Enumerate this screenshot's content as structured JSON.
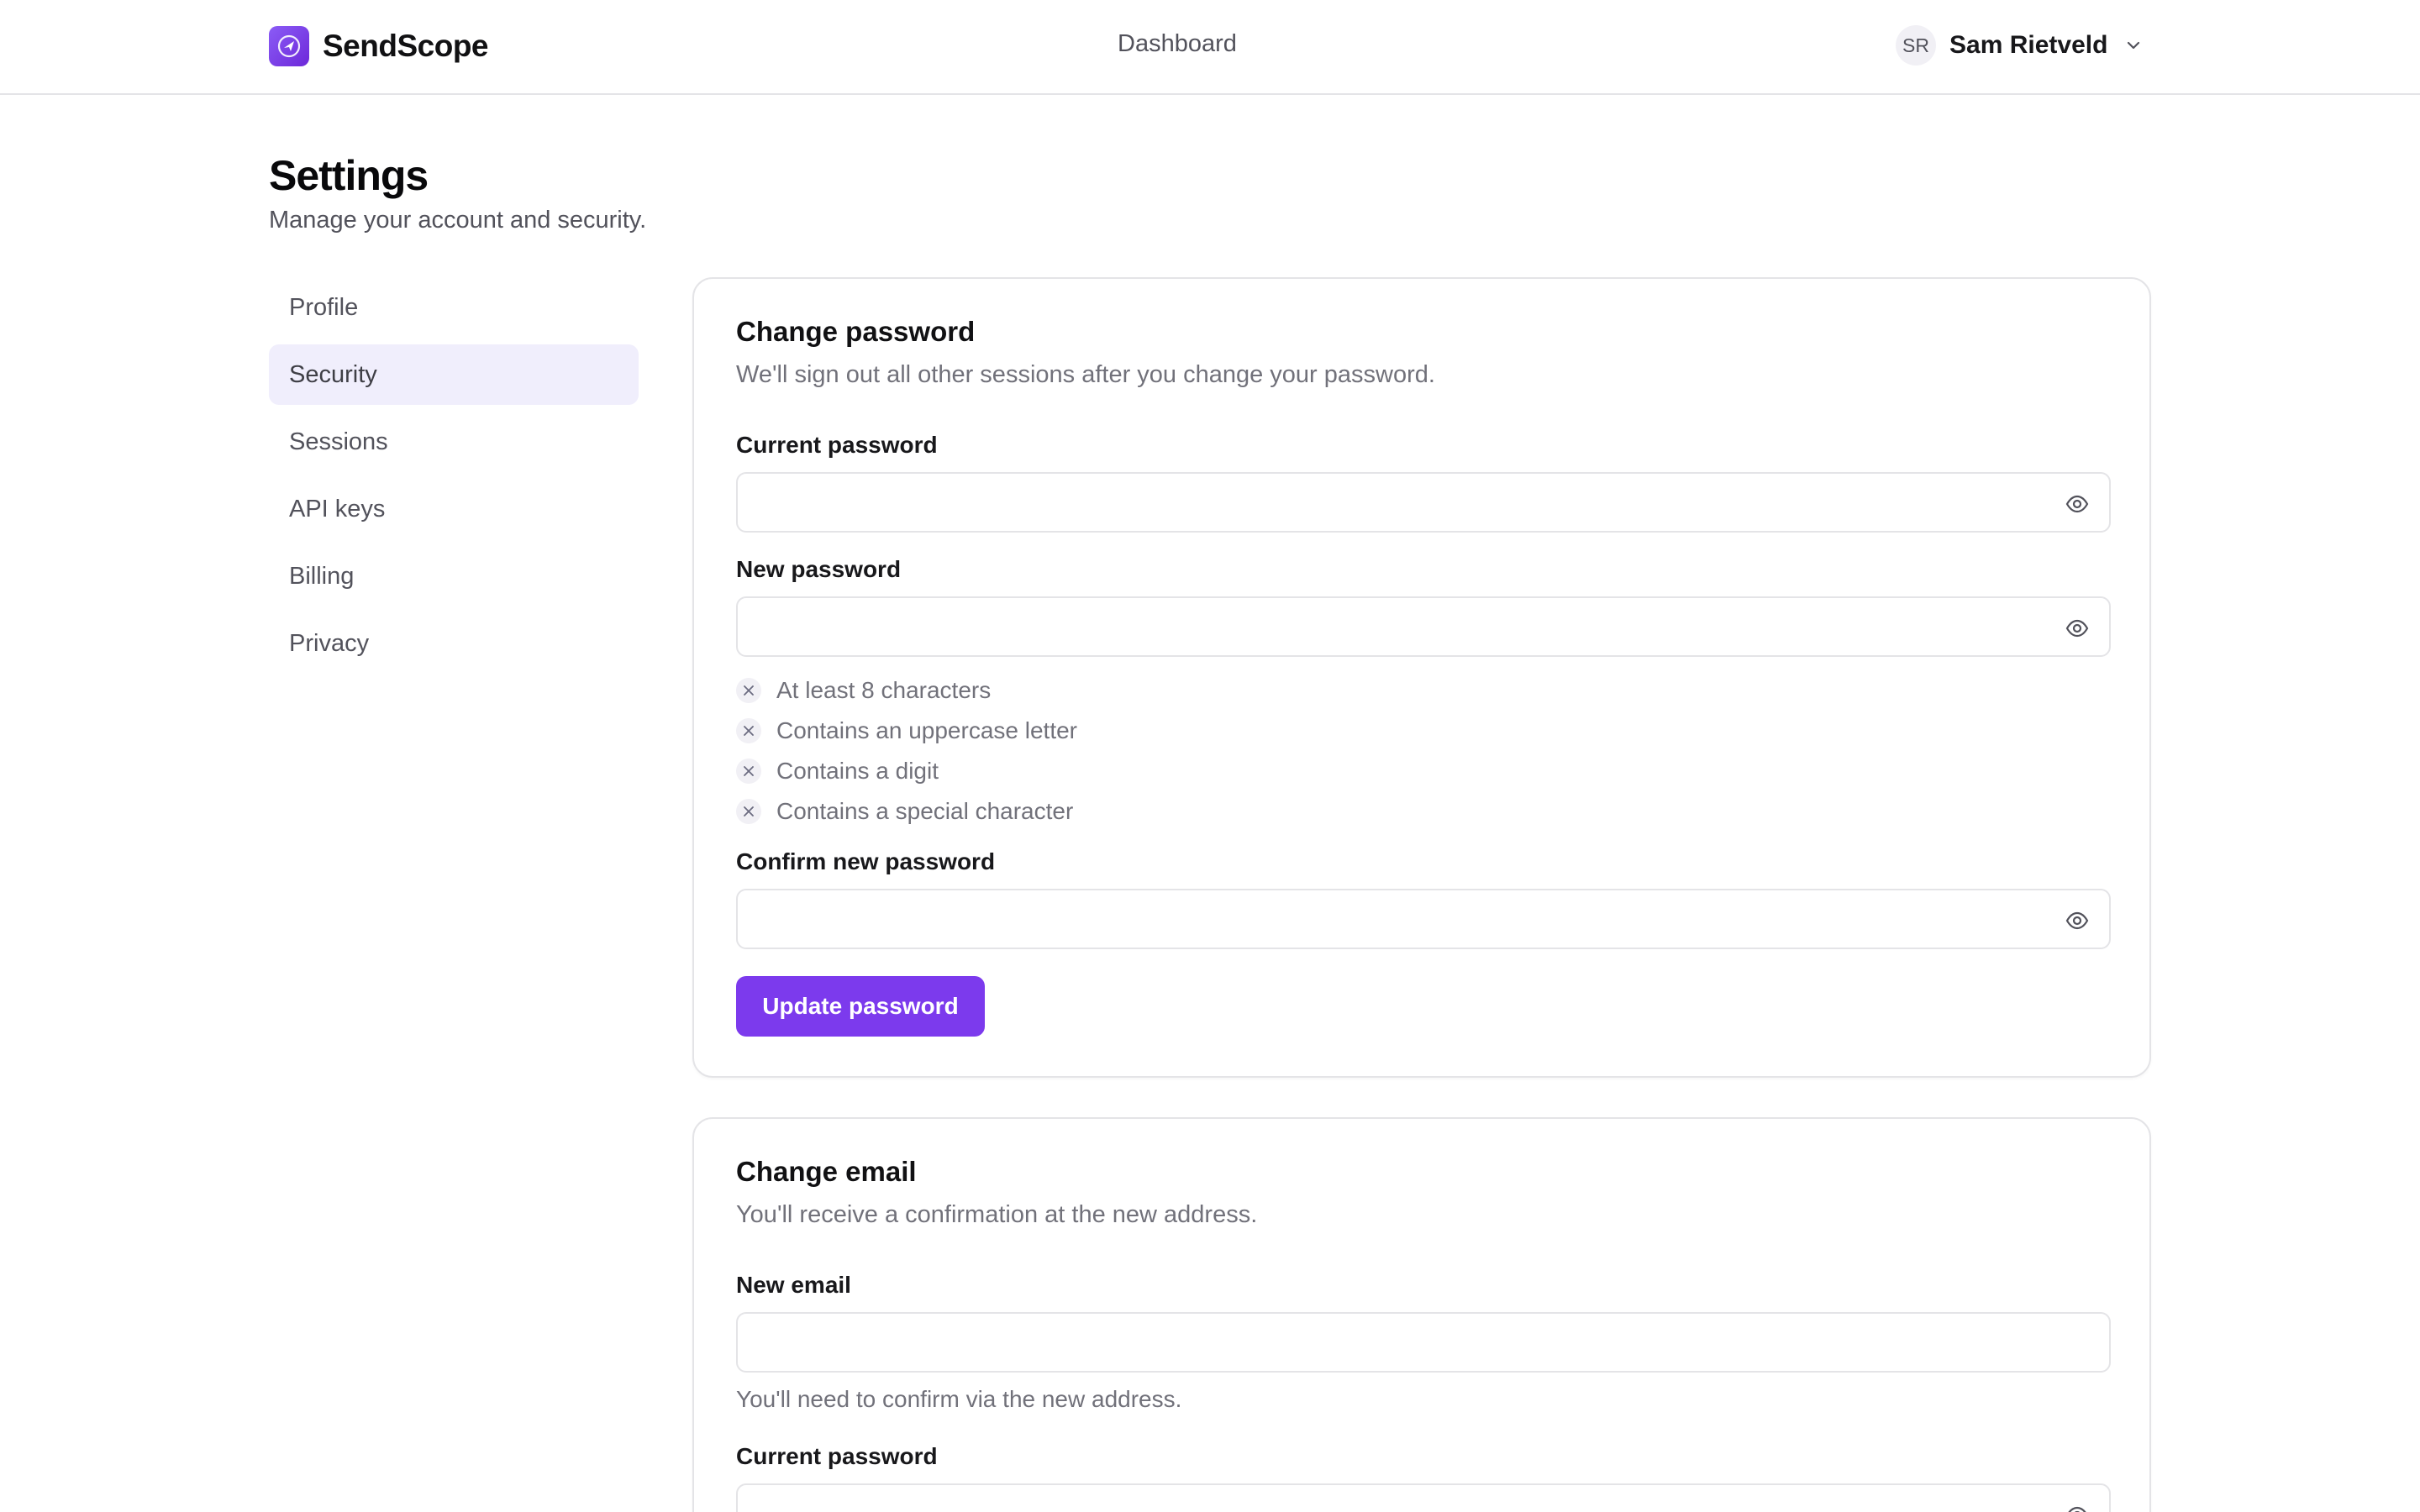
{
  "app": {
    "name": "SendScope"
  },
  "nav": {
    "dashboard": "Dashboard"
  },
  "user": {
    "initials": "SR",
    "name": "Sam Rietveld"
  },
  "page": {
    "title": "Settings",
    "subtitle": "Manage your account and security."
  },
  "sidebar": {
    "items": [
      {
        "label": "Profile",
        "active": false
      },
      {
        "label": "Security",
        "active": true
      },
      {
        "label": "Sessions",
        "active": false
      },
      {
        "label": "API keys",
        "active": false
      },
      {
        "label": "Billing",
        "active": false
      },
      {
        "label": "Privacy",
        "active": false
      }
    ]
  },
  "change_password": {
    "title": "Change password",
    "description": "We'll sign out all other sessions after you change your password.",
    "current_label": "Current password",
    "current_value": "",
    "new_label": "New password",
    "new_value": "",
    "requirements": [
      {
        "text": "At least 8 characters",
        "met": false
      },
      {
        "text": "Contains an uppercase letter",
        "met": false
      },
      {
        "text": "Contains a digit",
        "met": false
      },
      {
        "text": "Contains a special character",
        "met": false
      }
    ],
    "confirm_label": "Confirm new password",
    "confirm_value": "",
    "submit_label": "Update password"
  },
  "change_email": {
    "title": "Change email",
    "description": "You'll receive a confirmation at the new address.",
    "email_label": "New email",
    "email_value": "",
    "email_hint": "You'll need to confirm via the new address.",
    "current_label": "Current password",
    "current_value": ""
  },
  "colors": {
    "accent": "#7c3aed",
    "sidebar_active_bg": "#f0eefc",
    "border": "#e4e4e7",
    "muted_text": "#71717a"
  },
  "icons": {
    "logo": "paper-plane-compass-icon",
    "chevron": "chevron-down-icon",
    "eye": "eye-icon",
    "requirement_unmet": "x-icon"
  }
}
